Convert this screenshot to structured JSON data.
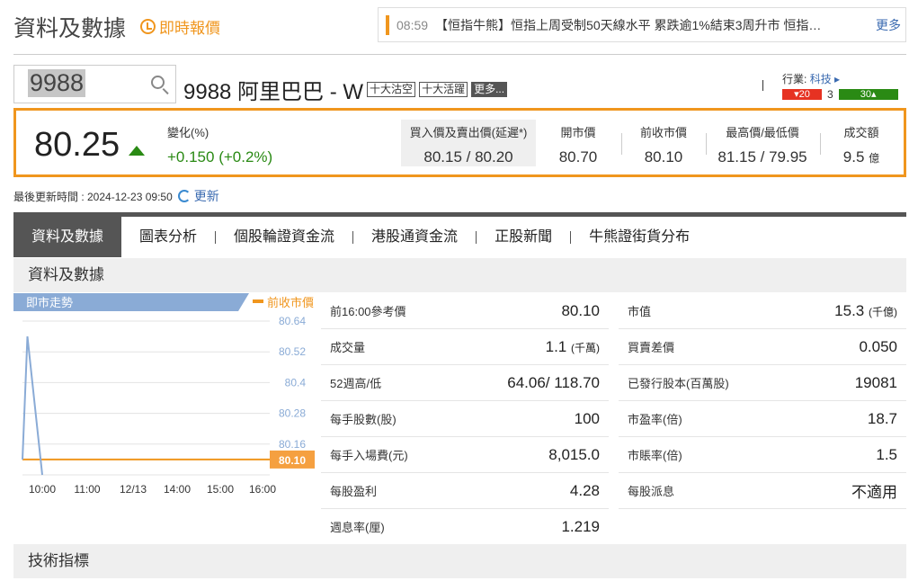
{
  "header": {
    "title": "資料及數據",
    "realtime": "即時報價"
  },
  "news": {
    "time": "08:59",
    "text": "【恒指牛熊】恒指上周受制50天線水平 累跌逾1%結束3周升市 恒指…",
    "more": "更多"
  },
  "search": {
    "value": "9988"
  },
  "stock": {
    "name": "9988 阿里巴巴 - W",
    "tags": [
      "十大沽空",
      "十大活躍"
    ],
    "more": "更多..."
  },
  "industry": {
    "label": "行業:",
    "value": "科技",
    "down": "20",
    "flat": "3",
    "up": "30"
  },
  "quote": {
    "price": "80.25",
    "change_label": "變化(%)",
    "change": "+0.150 (+0.2%)",
    "cols": [
      {
        "label": "買入價及賣出價(延遲*)",
        "value": "80.15 / 80.20"
      },
      {
        "label": "開市價",
        "value": "80.70"
      },
      {
        "label": "前收市價",
        "value": "80.10"
      },
      {
        "label": "最高價/最低價",
        "value": "81.15 / 79.95"
      },
      {
        "label": "成交額",
        "value": "9.5",
        "unit": "億"
      }
    ]
  },
  "update": {
    "text": "最後更新時間 : 2024-12-23 09:50",
    "refresh": "更新"
  },
  "tabs": [
    "資料及數據",
    "圖表分析",
    "個股輪證資金流",
    "港股通資金流",
    "正股新聞",
    "牛熊證街貨分布"
  ],
  "section1": "資料及數據",
  "section2": "技術指標",
  "chart_data": {
    "type": "line",
    "title": "即市走勢",
    "legend": "前收市價",
    "prev_close": 80.1,
    "prev_close_label": "80.10",
    "x_ticks": [
      "10:00",
      "11:00",
      "12/13",
      "14:00",
      "15:00",
      "16:00"
    ],
    "y_ticks": [
      "80.64",
      "80.52",
      "80.4",
      "80.28",
      "80.16"
    ],
    "ylim": [
      80.04,
      80.64
    ],
    "series": [
      {
        "name": "price",
        "t": [
          0,
          0.05,
          0.2
        ],
        "values": [
          80.1,
          80.58,
          80.04
        ]
      }
    ]
  },
  "left_table": [
    {
      "label": "前16:00參考價",
      "value": "80.10"
    },
    {
      "label": "成交量",
      "value": "1.1",
      "unit": "(千萬)"
    },
    {
      "label": "52週高/低",
      "value": "64.06/ 118.70"
    },
    {
      "label": "每手股數(股)",
      "value": "100"
    },
    {
      "label": "每手入場費(元)",
      "value": "8,015.0"
    },
    {
      "label": "每股盈利",
      "value": "4.28"
    },
    {
      "label": "週息率(厘)",
      "value": "1.219"
    }
  ],
  "right_table": [
    {
      "label": "市值",
      "value": "15.3",
      "unit": "(千億)"
    },
    {
      "label": "買賣差價",
      "value": "0.050"
    },
    {
      "label": "已發行股本(百萬股)",
      "value": "19081"
    },
    {
      "label": "市盈率(倍)",
      "value": "18.7"
    },
    {
      "label": "市賬率(倍)",
      "value": "1.5"
    },
    {
      "label": "每股派息",
      "value": "不適用"
    }
  ]
}
